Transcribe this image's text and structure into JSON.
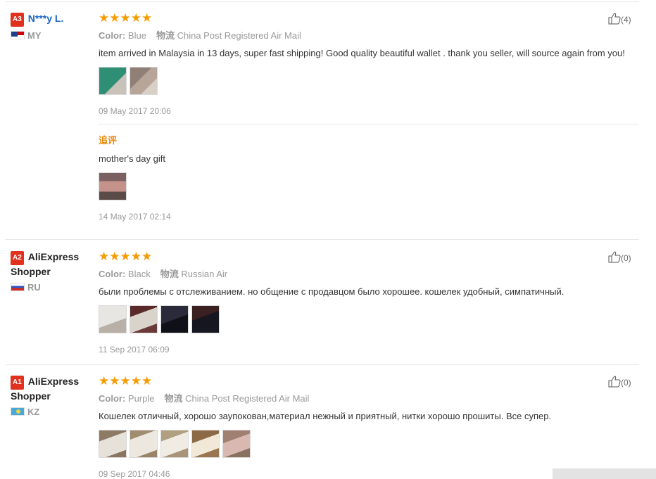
{
  "reviews": [
    {
      "level": "A3",
      "name": "N***y L.",
      "country": "MY",
      "stars": "★★★★★",
      "color_label": "Color:",
      "color_value": "Blue",
      "ship_label": "物流",
      "ship_value": "China Post Registered Air Mail",
      "text": "item arrived in Malaysia in 13 days, super fast shipping! Good quality beautiful wallet . thank you seller, will source again from you!",
      "photos": [
        "#3a8f7a",
        "#9a8a7e"
      ],
      "date": "09 May 2017 20:06",
      "likes": "(4)",
      "followup": {
        "label": "追评",
        "text": "mother's day gift",
        "photos": [
          "#b07a6e"
        ],
        "date": "14 May 2017 02:14"
      }
    },
    {
      "level": "A2",
      "name": "AliExpress Shopper",
      "country": "RU",
      "stars": "★★★★★",
      "color_label": "Color:",
      "color_value": "Black",
      "ship_label": "物流",
      "ship_value": "Russian Air",
      "text": "были проблемы с отслеживанием. но общение с продавцом было хорошее. кошелек удобный, симпатичный.",
      "photos": [
        "#d8d4cc",
        "#6a3a38",
        "#1a1a2a",
        "#20202a"
      ],
      "date": "11 Sep 2017 06:09",
      "likes": "(0)"
    },
    {
      "level": "A1",
      "name": "AliExpress Shopper",
      "country": "KZ",
      "stars": "★★★★★",
      "color_label": "Color:",
      "color_value": "Purple",
      "ship_label": "物流",
      "ship_value": "China Post Registered Air Mail",
      "text": "Кошелек отличный, хорошо заупокован,материал нежный и приятный, нитки хорошо прошиты. Все супер.",
      "photos": [
        "#a89880",
        "#b8a890",
        "#c0b090",
        "#a08060",
        "#b09080"
      ],
      "date": "09 Sep 2017 04:46",
      "likes": "(0)"
    }
  ]
}
